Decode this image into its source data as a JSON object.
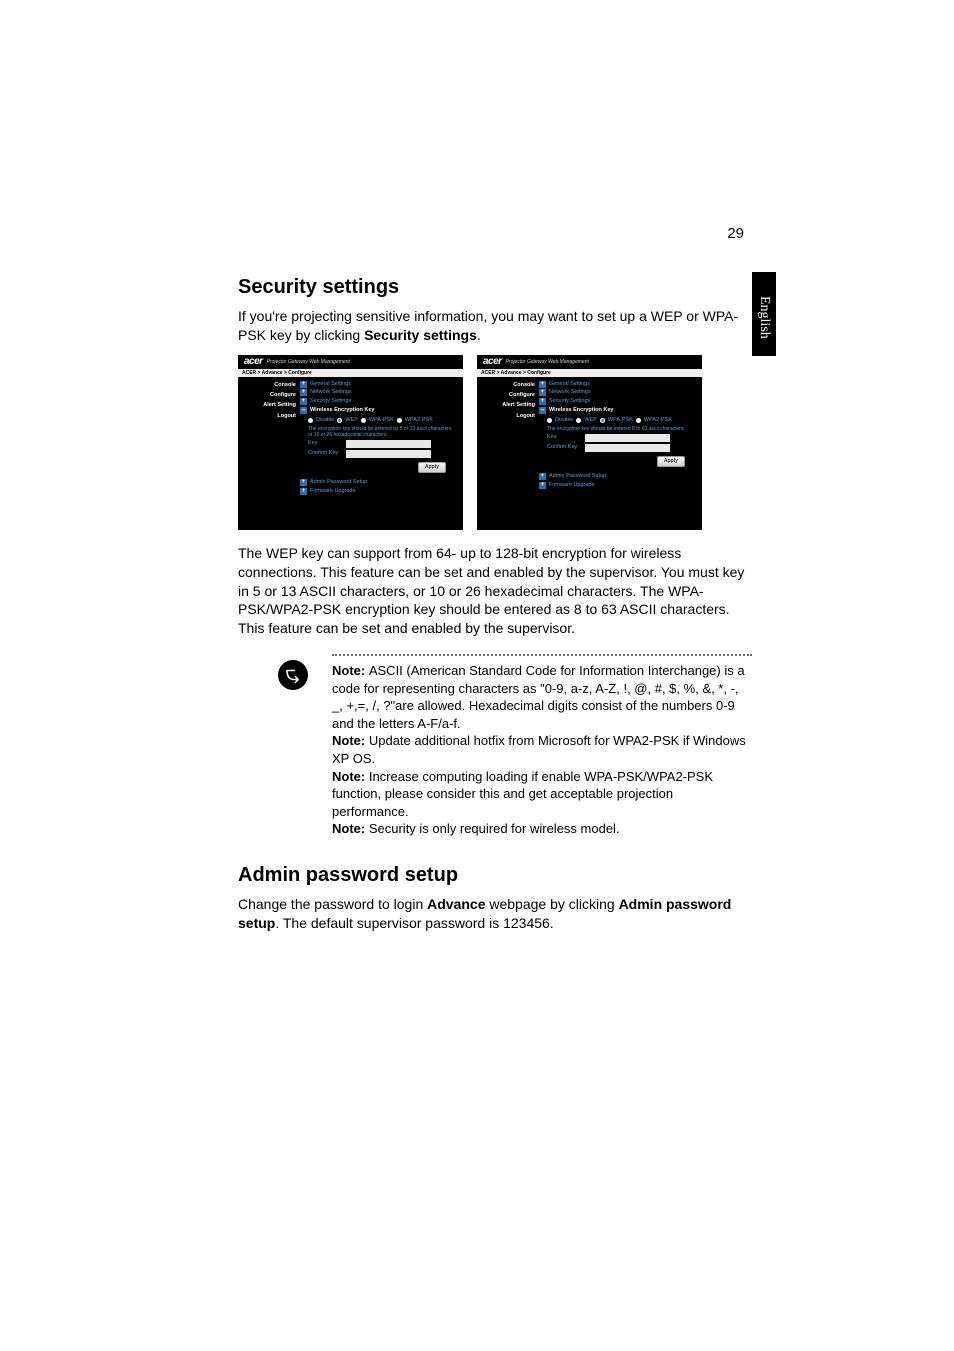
{
  "page_number": "29",
  "side_tab": "English",
  "sec1": {
    "heading": "Security settings",
    "intro_a": "If you're projecting sensitive information, you may want to set up a WEP or WPA-PSK key by clicking ",
    "intro_b": "Security settings",
    "intro_c": "."
  },
  "screens": {
    "breadcrumb": "ACER > Advance > Configure",
    "logo": "acer",
    "logo_sub": "Projector Gateway Web Management",
    "sidebar": {
      "console": "Console",
      "configure": "Configure",
      "alert": "Alert Setting",
      "logout": "Logout"
    },
    "items": {
      "general": "General Settings",
      "network": "Network Settings",
      "security": "Security Settings",
      "wep_key": "Wireless Encryption Key",
      "admin_pw": "Admin Password Setup",
      "fw": "Firmware Upgrade"
    },
    "radios": {
      "disable": "Disable",
      "wep": "WEP",
      "wpa": "WPA-PSK",
      "wpa2": "WPA2-PSK"
    },
    "desc_wep": "The encryption key should be entered as 5 or 13 ascii characters or 10 or 26 hexadecimal characters.",
    "desc_wpa": "The encryption key should be entered 8 to 63 ascii characters.",
    "labels": {
      "key": "Key",
      "confirm": "Confirm Key"
    },
    "apply": "Apply"
  },
  "paragraph2": "The WEP key can support from 64- up to 128-bit encryption for wireless connections. This feature can be set and enabled by  the supervisor. You must key in 5 or 13 ASCII characters, or 10 or 26 hexadecimal characters.  The WPA-PSK/WPA2-PSK encryption key should be entered as 8 to 63 ASCII characters. This feature can be set and enabled by the supervisor.",
  "notes": {
    "label": "Note: ",
    "n1": "ASCII (American Standard Code for Information Interchange) is a code for representing characters as \"0-9, a-z, A-Z, !, @, #, $, %, &, *, -, _, +,=, /, ?\"are allowed. Hexadecimal digits consist of the numbers 0-9 and the letters A-F/a-f.",
    "n2": "Update additional hotfix from Microsoft for WPA2-PSK if Windows XP OS.",
    "n3": "Increase computing loading if enable WPA-PSK/WPA2-PSK function, please consider this and get acceptable projection performance.",
    "n4": "Security is only required for wireless model."
  },
  "sec2": {
    "heading": "Admin password setup",
    "p_a": "Change the password to login ",
    "p_b": "Advance",
    "p_c": " webpage by clicking ",
    "p_d": "Admin password setup",
    "p_e": ". The default supervisor password is 123456."
  }
}
